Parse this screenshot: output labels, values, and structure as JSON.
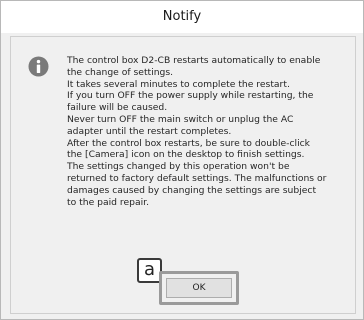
{
  "dialog": {
    "title": "Notify",
    "icon": "info-icon",
    "message": "The control box D2-CB restarts automatically to enable\nthe change of settings.\nIt takes several minutes to complete the restart.\nIf you turn OFF the power supply while restarting, the\nfailure will be caused.\nNever turn OFF the main switch or unplug the AC\nadapter until the restart completes.\nAfter the control box restarts, be sure to double-click\nthe [Camera] icon on the desktop to finish settings.\nThe settings changed by this operation won't be\nreturned to factory default settings. The malfunctions or\ndamages caused by changing the settings are subject\nto the paid repair.",
    "ok_label": "OK"
  },
  "callout": {
    "label": "a"
  },
  "colors": {
    "icon_fill": "#7a7a7a",
    "highlight_border": "#9a9a9a",
    "background": "#f0f0f0"
  }
}
